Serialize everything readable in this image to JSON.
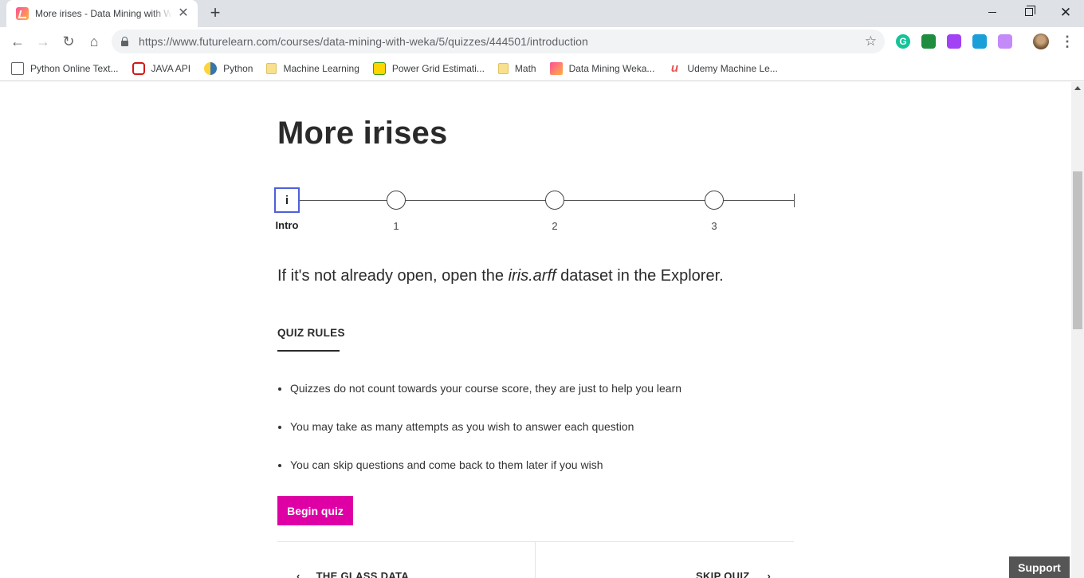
{
  "browser": {
    "tab_title": "More irises - Data Mining with Weka",
    "tab_close": "✕",
    "new_tab": "+",
    "url_host": "https://www.futurelearn.com",
    "url_path": "/courses/data-mining-with-weka/5/quizzes/444501/introduction",
    "bookmarks": [
      {
        "label": "Python Online Text...",
        "icon": "text-doc-icon"
      },
      {
        "label": "JAVA API",
        "icon": "oracle-icon"
      },
      {
        "label": "Python",
        "icon": "python-icon"
      },
      {
        "label": "Machine Learning",
        "icon": "folder-icon"
      },
      {
        "label": "Power Grid Estimati...",
        "icon": "smiley-icon"
      },
      {
        "label": "Math",
        "icon": "folder-icon"
      },
      {
        "label": "Data Mining Weka...",
        "icon": "futurelearn-icon"
      },
      {
        "label": "Udemy Machine Le...",
        "icon": "udemy-icon"
      }
    ]
  },
  "page": {
    "title": "More irises",
    "steps": [
      {
        "node": "i",
        "label": "Intro"
      },
      {
        "node": "",
        "label": "1"
      },
      {
        "node": "",
        "label": "2"
      },
      {
        "node": "",
        "label": "3"
      }
    ],
    "lead_pre": "If it's not already open, open the ",
    "lead_em": "iris.arff",
    "lead_post": " dataset in the Explorer.",
    "rules_heading": "QUIZ RULES",
    "rules": [
      "Quizzes do not count towards your course score, they are just to help you learn",
      "You may take as many attempts as you wish to answer each question",
      "You can skip questions and come back to them later if you wish"
    ],
    "begin_label": "Begin quiz",
    "prev_label": "THE GLASS DATA",
    "next_label": "SKIP QUIZ",
    "support_label": "Support"
  },
  "colors": {
    "accent": "#de00a5",
    "step_active": "#4f60d8"
  }
}
